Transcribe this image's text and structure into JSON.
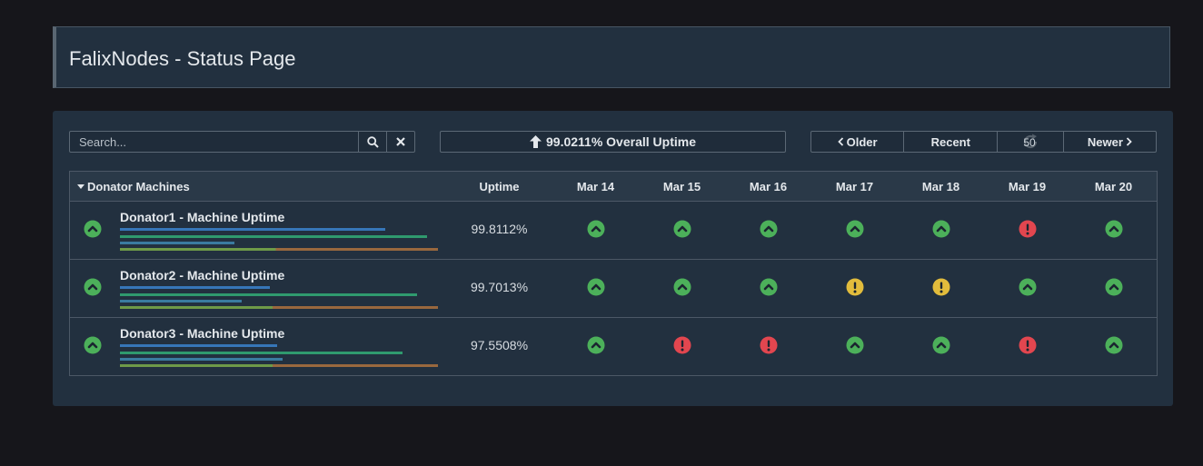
{
  "header": {
    "title": "FalixNodes - Status Page"
  },
  "search": {
    "placeholder": "Search..."
  },
  "overall": {
    "text": "99.0211% Overall Uptime"
  },
  "pager": {
    "older": "Older",
    "recent": "Recent",
    "refresh_count": "50",
    "newer": "Newer"
  },
  "table": {
    "group_label": "Donator Machines",
    "uptime_header": "Uptime",
    "dates": [
      "Mar 14",
      "Mar 15",
      "Mar 16",
      "Mar 17",
      "Mar 18",
      "Mar 19",
      "Mar 20"
    ],
    "rows": [
      {
        "name": "Donator1 - Machine Uptime",
        "uptime": "99.8112%",
        "days": [
          "up",
          "up",
          "up",
          "up",
          "up",
          "down",
          "up"
        ]
      },
      {
        "name": "Donator2 - Machine Uptime",
        "uptime": "99.7013%",
        "days": [
          "up",
          "up",
          "up",
          "warn",
          "warn",
          "up",
          "up"
        ]
      },
      {
        "name": "Donator3 - Machine Uptime",
        "uptime": "97.5508%",
        "days": [
          "up",
          "down",
          "down",
          "up",
          "up",
          "down",
          "up"
        ]
      }
    ]
  },
  "colors": {
    "up": "#4cb05a",
    "warn": "#e2bc3c",
    "down": "#e2464f"
  },
  "icons": {
    "up": "chevron-up-circle-icon",
    "warn": "exclamation-circle-icon",
    "down": "exclamation-circle-icon"
  }
}
